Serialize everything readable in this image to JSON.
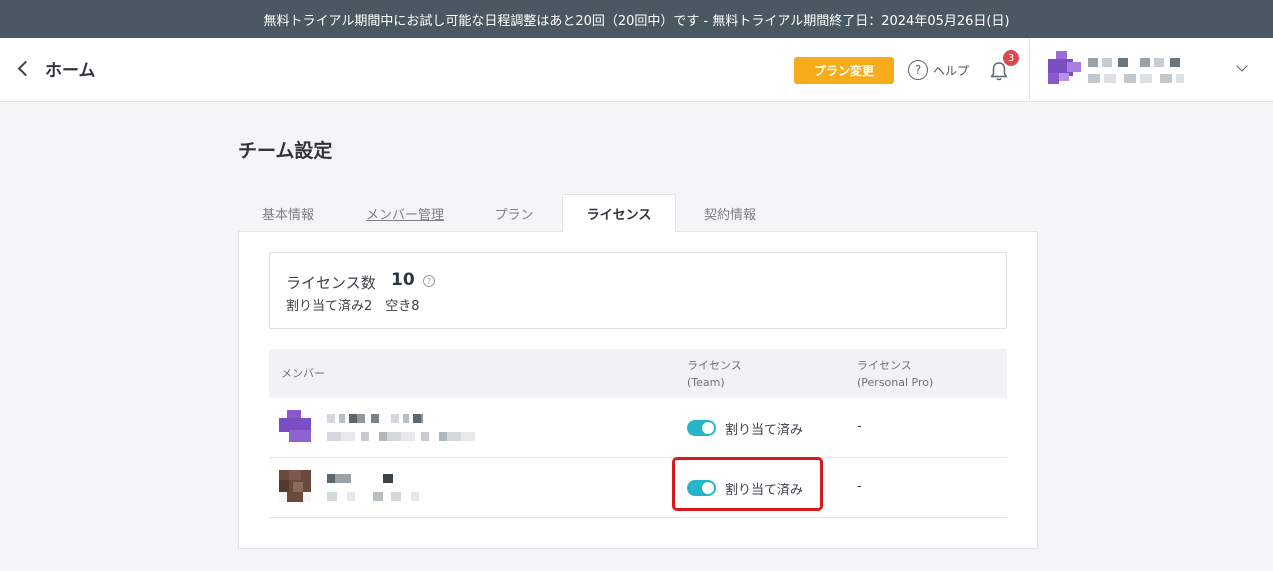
{
  "banner": {
    "text": "無料トライアル期間中にお試し可能な日程調整はあと20回（20回中）です - 無料トライアル期間終了日：2024年05月26日(日)"
  },
  "header": {
    "back_label": "ホーム",
    "plan_button": "プラン変更",
    "help_label": "ヘルプ",
    "help_icon_glyph": "?",
    "notification_count": "3"
  },
  "page": {
    "title": "チーム設定"
  },
  "tabs": [
    {
      "label": "基本情報",
      "active": false
    },
    {
      "label": "メンバー管理",
      "active": false
    },
    {
      "label": "プラン",
      "active": false
    },
    {
      "label": "ライセンス",
      "active": true
    },
    {
      "label": "契約情報",
      "active": false
    }
  ],
  "license": {
    "count_label": "ライセンス数",
    "count_value": "10",
    "info_glyph": "?",
    "assignment_summary": "割り当て済み2　空き8"
  },
  "table": {
    "headers": {
      "member": "メンバー",
      "team_line1": "ライセンス",
      "team_line2": "(Team)",
      "personal_line1": "ライセンス",
      "personal_line2": "(Personal Pro)"
    },
    "rows": [
      {
        "team_status": "割り当て済み",
        "team_enabled": true,
        "personal_status": "-"
      },
      {
        "team_status": "割り当て済み",
        "team_enabled": true,
        "personal_status": "-"
      }
    ]
  },
  "colors": {
    "banner_bg": "#4a5961",
    "plan_button": "#f6ac1b",
    "toggle_on": "#26b5c9",
    "badge": "#e0484f",
    "highlight": "#d7191c"
  }
}
